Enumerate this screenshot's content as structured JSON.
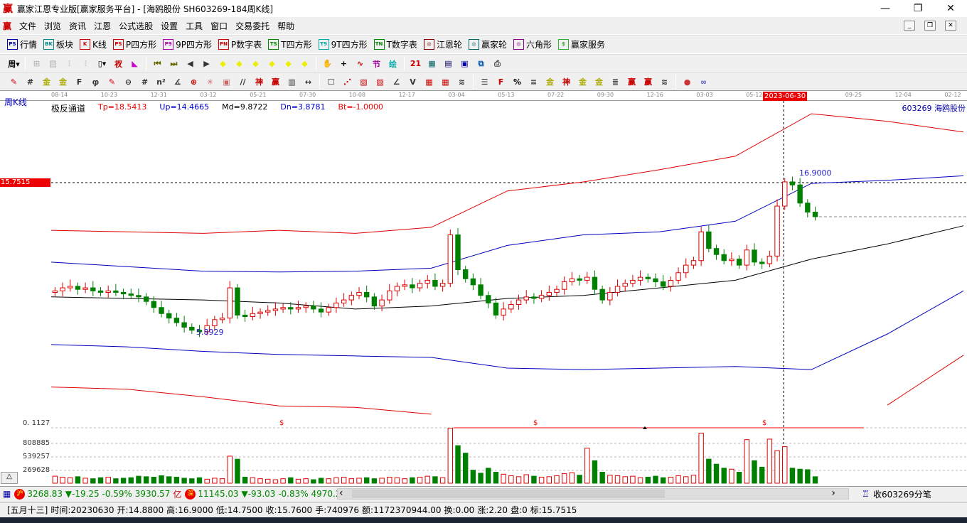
{
  "window": {
    "title": "赢家江恩专业版[赢家服务平台] - [海鸥股份  SH603269-184周K线]",
    "logo": "赢",
    "min": "—",
    "max": "❐",
    "close": "✕"
  },
  "menu": [
    "文件",
    "浏览",
    "资讯",
    "江恩",
    "公式选股",
    "设置",
    "工具",
    "窗口",
    "交易委托",
    "帮助"
  ],
  "toolbar1": [
    {
      "icon": "PS",
      "label": "行情",
      "color": "#00a"
    },
    {
      "icon": "BK",
      "label": "板块",
      "color": "#088"
    },
    {
      "icon": "K",
      "label": "K线",
      "color": "#c00"
    },
    {
      "icon": "PS",
      "label": "P四方形",
      "color": "#c00"
    },
    {
      "icon": "P9",
      "label": "9P四方形",
      "color": "#a0a"
    },
    {
      "icon": "PN",
      "label": "P数字表",
      "color": "#c00"
    },
    {
      "icon": "TS",
      "label": "T四方形",
      "color": "#080"
    },
    {
      "icon": "T9",
      "label": "9T四方形",
      "color": "#0aa"
    },
    {
      "icon": "TN",
      "label": "T数字表",
      "color": "#080"
    },
    {
      "icon": "◎",
      "label": "江恩轮",
      "color": "#800"
    },
    {
      "icon": "◎",
      "label": "赢家轮",
      "color": "#066"
    },
    {
      "icon": "◎",
      "label": "六角形",
      "color": "#808"
    },
    {
      "icon": "$",
      "label": "赢家服务",
      "color": "#3a3"
    }
  ],
  "toolbar2": [
    {
      "name": "period-week-icon",
      "g": "周▾",
      "c": "#000"
    },
    {
      "name": "sep"
    },
    {
      "name": "gray-tool-1-icon",
      "g": "⊞",
      "c": "#bbb"
    },
    {
      "name": "gray-tool-2-icon",
      "g": "目",
      "c": "#bbb"
    },
    {
      "name": "gray-tool-3-icon",
      "g": "⫶",
      "c": "#bbb"
    },
    {
      "name": "gray-tool-4-icon",
      "g": "⫶",
      "c": "#bbb"
    },
    {
      "name": "candle-type-icon",
      "g": "▯▾",
      "c": "#000"
    },
    {
      "name": "formula-icon",
      "g": "衩",
      "c": "#c00"
    },
    {
      "name": "flag-icon",
      "g": "◣",
      "c": "#c0c"
    },
    {
      "name": "sep"
    },
    {
      "name": "first-icon",
      "g": "⏮",
      "c": "#660"
    },
    {
      "name": "last-icon",
      "g": "⏭",
      "c": "#660"
    },
    {
      "name": "left-icon",
      "g": "◀",
      "c": "#333"
    },
    {
      "name": "right-icon",
      "g": "▶",
      "c": "#333"
    },
    {
      "name": "nav-left-icon",
      "g": "◆",
      "c": "#ee0"
    },
    {
      "name": "nav-right-icon",
      "g": "◆",
      "c": "#ee0"
    },
    {
      "name": "zoom-h-icon",
      "g": "◆",
      "c": "#ee0"
    },
    {
      "name": "zoom-x-icon",
      "g": "◆",
      "c": "#ee0"
    },
    {
      "name": "zoom-in-icon",
      "g": "◆",
      "c": "#ee0"
    },
    {
      "name": "zoom-v-icon",
      "g": "◆",
      "c": "#ee0"
    },
    {
      "name": "sep"
    },
    {
      "name": "hand-icon",
      "g": "✋",
      "c": "#333"
    },
    {
      "name": "crosshair-icon",
      "g": "+",
      "c": "#000"
    },
    {
      "name": "pen-icon",
      "g": "∿",
      "c": "#c00"
    },
    {
      "name": "node-icon",
      "g": "节",
      "c": "#a0a"
    },
    {
      "name": "pattern-icon",
      "g": "绘",
      "c": "#0aa"
    },
    {
      "name": "sep"
    },
    {
      "name": "calendar-icon",
      "g": "21",
      "c": "#c00"
    },
    {
      "name": "calculator-icon",
      "g": "▦",
      "c": "#066"
    },
    {
      "name": "notes-icon",
      "g": "▤",
      "c": "#006"
    },
    {
      "name": "save-icon",
      "g": "▣",
      "c": "#00a"
    },
    {
      "name": "export-icon",
      "g": "⧉",
      "c": "#05a"
    },
    {
      "name": "print-icon",
      "g": "⎙",
      "c": "#444"
    }
  ],
  "toolbar3": [
    {
      "name": "draw-pen-icon",
      "g": "✎",
      "c": "#c00"
    },
    {
      "name": "grid-icon",
      "g": "#",
      "c": "#333"
    },
    {
      "name": "gold-1-icon",
      "g": "金",
      "c": "#aa0"
    },
    {
      "name": "gold-2-icon",
      "g": "金",
      "c": "#aa0"
    },
    {
      "name": "f-tool-icon",
      "g": "F",
      "c": "#333"
    },
    {
      "name": "spiral-icon",
      "g": "ჶ",
      "c": "#333"
    },
    {
      "name": "pen2-icon",
      "g": "✎",
      "c": "#c00"
    },
    {
      "name": "circle-tool-icon",
      "g": "⊖",
      "c": "#333"
    },
    {
      "name": "grid2-icon",
      "g": "#",
      "c": "#333"
    },
    {
      "name": "n2-icon",
      "g": "n²",
      "c": "#333"
    },
    {
      "name": "angle-icon",
      "g": "∡",
      "c": "#333"
    },
    {
      "name": "target-icon",
      "g": "⊕",
      "c": "#c00"
    },
    {
      "name": "star-icon",
      "g": "✳",
      "c": "#c66"
    },
    {
      "name": "square-web-icon",
      "g": "▣",
      "c": "#c66"
    },
    {
      "name": "parallel-icon",
      "g": "//",
      "c": "#333"
    },
    {
      "name": "god-icon",
      "g": "神",
      "c": "#c00"
    },
    {
      "name": "win-icon",
      "g": "赢",
      "c": "#c00"
    },
    {
      "name": "ruler-icon",
      "g": "▥",
      "c": "#333"
    },
    {
      "name": "width-icon",
      "g": "↔",
      "c": "#333"
    },
    {
      "name": "sep"
    },
    {
      "name": "box-icon",
      "g": "☐",
      "c": "#333"
    },
    {
      "name": "fan-icon",
      "g": "⋰",
      "c": "#c00"
    },
    {
      "name": "fan-box-icon",
      "g": "▧",
      "c": "#c00"
    },
    {
      "name": "fan-box2-icon",
      "g": "▨",
      "c": "#c00"
    },
    {
      "name": "angle2-icon",
      "g": "∠",
      "c": "#333"
    },
    {
      "name": "v-icon",
      "g": "V",
      "c": "#333"
    },
    {
      "name": "gann-grid-icon",
      "g": "▦",
      "c": "#c00"
    },
    {
      "name": "gann-grid2-icon",
      "g": "▦",
      "c": "#c00"
    },
    {
      "name": "lines-icon",
      "g": "≋",
      "c": "#333"
    },
    {
      "name": "sep"
    },
    {
      "name": "list-icon",
      "g": "☰",
      "c": "#333"
    },
    {
      "name": "f-red-icon",
      "g": "F",
      "c": "#c00"
    },
    {
      "name": "percent-icon",
      "g": "%",
      "c": "#000"
    },
    {
      "name": "steps-icon",
      "g": "≡",
      "c": "#333"
    },
    {
      "name": "gold-3-icon",
      "g": "金",
      "c": "#aa0"
    },
    {
      "name": "god-2-icon",
      "g": "神",
      "c": "#c00"
    },
    {
      "name": "gold-4-icon",
      "g": "金",
      "c": "#aa0"
    },
    {
      "name": "gold-5-icon",
      "g": "金",
      "c": "#aa0"
    },
    {
      "name": "gann-3-icon",
      "g": "≣",
      "c": "#333"
    },
    {
      "name": "win-2-icon",
      "g": "赢",
      "c": "#c00"
    },
    {
      "name": "win-3-icon",
      "g": "赢",
      "c": "#c00"
    },
    {
      "name": "lines-2-icon",
      "g": "≋",
      "c": "#333"
    },
    {
      "name": "sep"
    },
    {
      "name": "ball-icon",
      "g": "●",
      "c": "#c33"
    },
    {
      "name": "infinity-icon",
      "g": "∞",
      "c": "#55c"
    }
  ],
  "chart": {
    "period_label": "周K线",
    "time_labels": [
      "08-14",
      "10-23",
      "12-31",
      "03-12",
      "05-21",
      "07-30",
      "10-08",
      "12-17",
      "03-04",
      "05-13",
      "07-22",
      "09-30",
      "12-16",
      "03-03",
      "05-12",
      "",
      "09-25",
      "12-04",
      "02-12"
    ],
    "cursor_date": "2023-06-30",
    "indicator_name": "极反通道",
    "tp": "Tp=18.5413",
    "up": "Up=14.4665",
    "md": "Md=9.8722",
    "dn": "Dn=3.8781",
    "bt": "Bt=-1.0000",
    "stock": "603269  海鸥股份",
    "cursor_price": "15.7515",
    "high_label": "16.9000",
    "low_label": "5.8929",
    "indicator2_value": "0. 1127",
    "dollar_marks": [
      "$",
      "$",
      "$"
    ],
    "volume_ticks": [
      "808885",
      "539257",
      "269628"
    ],
    "scroll_up": "△",
    "colors": {
      "up": "#e00000",
      "down": "#008000",
      "tp": "#e00000",
      "band": "#0000c0",
      "md": "#000000"
    }
  },
  "chart_data": {
    "type": "candlestick",
    "title": "海鸥股份 SH603269 周K线",
    "indicator": "极反通道",
    "slots": 120,
    "close": [
      8.6,
      8.8,
      8.9,
      8.7,
      8.8,
      8.6,
      8.5,
      8.6,
      8.5,
      8.4,
      8.3,
      8.2,
      7.9,
      7.5,
      7.1,
      6.8,
      6.5,
      6.2,
      6.0,
      5.9,
      6.3,
      6.7,
      6.8,
      8.8,
      7.0,
      6.9,
      7.1,
      7.2,
      7.3,
      7.4,
      7.5,
      7.4,
      7.5,
      7.6,
      7.4,
      7.2,
      7.5,
      7.8,
      8.0,
      8.3,
      8.5,
      8.2,
      7.6,
      8.0,
      8.6,
      8.9,
      9.0,
      8.8,
      9.1,
      9.3,
      8.9,
      9.1,
      12.3,
      10.0,
      9.4,
      9.0,
      8.3,
      7.8,
      7.0,
      7.4,
      7.7,
      8.0,
      8.2,
      8.1,
      8.3,
      8.5,
      8.7,
      9.2,
      9.4,
      9.3,
      9.5,
      8.7,
      8.0,
      8.5,
      8.9,
      9.1,
      9.3,
      9.5,
      9.4,
      9.2,
      8.9,
      9.3,
      9.8,
      10.3,
      10.6,
      12.5,
      11.4,
      11.0,
      10.6,
      10.7,
      10.3,
      11.3,
      10.5,
      10.4,
      10.9,
      14.2,
      15.8,
      15.6,
      14.4,
      13.8,
      13.5
    ],
    "volume": [
      140000,
      120000,
      110000,
      130000,
      100000,
      90000,
      110000,
      120000,
      90000,
      100000,
      110000,
      140000,
      130000,
      120000,
      150000,
      130000,
      120000,
      100000,
      90000,
      110000,
      80000,
      100000,
      90000,
      540000,
      480000,
      120000,
      110000,
      90000,
      80000,
      70000,
      90000,
      110000,
      80000,
      90000,
      70000,
      100000,
      90000,
      110000,
      120000,
      90000,
      100000,
      110000,
      90000,
      100000,
      120000,
      110000,
      90000,
      110000,
      120000,
      140000,
      130000,
      110000,
      1100000,
      750000,
      600000,
      260000,
      200000,
      300000,
      220000,
      180000,
      150000,
      130000,
      170000,
      140000,
      120000,
      130000,
      150000,
      190000,
      210000,
      160000,
      700000,
      450000,
      220000,
      160000,
      150000,
      130000,
      140000,
      110000,
      120000,
      140000,
      110000,
      120000,
      150000,
      130000,
      160000,
      1000000,
      480000,
      380000,
      300000,
      280000,
      220000,
      870000,
      450000,
      320000,
      880000,
      650000,
      730000,
      300000,
      280000,
      270000,
      130000
    ],
    "channels": {
      "sample_every_slots": 10,
      "tp": [
        12.6,
        12.5,
        12.4,
        12.6,
        12.4,
        12.8,
        15.2,
        15.8,
        16.6,
        17.5,
        20.3,
        19.8,
        19.1
      ],
      "up": [
        10.5,
        10.2,
        9.9,
        9.85,
        9.9,
        10.1,
        11.6,
        12.3,
        12.5,
        13.2,
        15.7,
        15.9,
        16.2
      ],
      "md": [
        8.2,
        8.1,
        8.0,
        7.8,
        7.4,
        7.6,
        8.1,
        8.3,
        8.8,
        9.3,
        10.7,
        11.7,
        12.9
      ],
      "dn": [
        5.05,
        4.9,
        4.6,
        4.4,
        4.3,
        4.2,
        3.5,
        3.4,
        3.5,
        3.6,
        3.4,
        5.75,
        8.6
      ],
      "bt": [
        2.25,
        2.1,
        1.6,
        1.0,
        0.9,
        0.45,
        null,
        null,
        null,
        null,
        null,
        1.05,
        4.35
      ]
    },
    "ylim": [
      -1,
      21
    ],
    "volume_ticks": [
      269628,
      539257,
      808885
    ]
  },
  "indexbar": {
    "sh_badge": "沪",
    "sh": "3268.83 ▼-19.25 -0.59% 3930.57",
    "sh_unit": "亿",
    "sz_badge": "深",
    "sz": "11145.03 ▼-93.03 -0.83% 4970.20",
    "prev": "‹",
    "next": "›",
    "feed": "收603269分笔"
  },
  "status": {
    "lunar": "[五月十三]",
    "time": "时间:20230630",
    "open": "开:14.8800",
    "high": "高:16.9000",
    "low": "低:14.7500",
    "close": "收:15.7600",
    "hands": "手:740976",
    "amount": "额:1172370944.00",
    "turnover": "换:0.00",
    "change": "涨:2.20",
    "pan": "盘:0",
    "mark": "标:15.7515"
  }
}
